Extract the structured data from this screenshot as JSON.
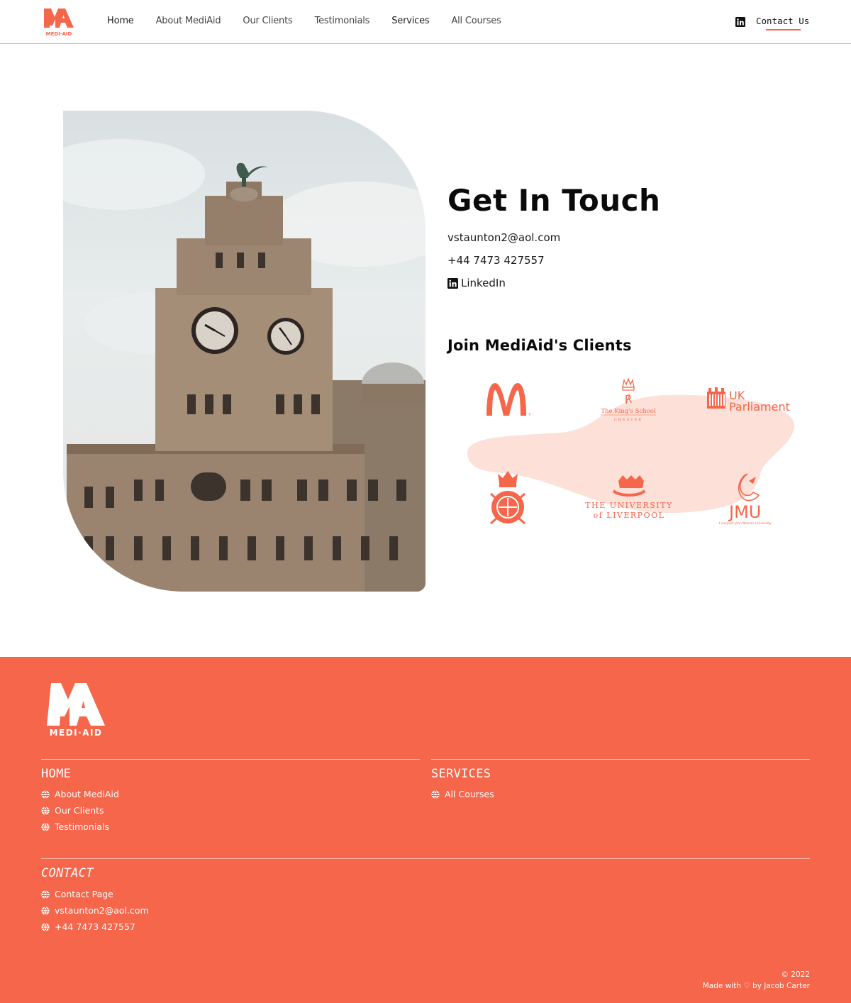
{
  "brand": {
    "logo_letters": "MA",
    "logo_wordmark": "MEDI·AID",
    "accent": "#f5664a",
    "blob": "#fde0d8"
  },
  "nav": {
    "links": [
      "Home",
      "About MediAid",
      "Our Clients",
      "Testimonials",
      "Services",
      "All Courses"
    ],
    "contact_label": "Contact Us",
    "linkedin_icon": "linkedin-icon"
  },
  "contact": {
    "title": "Get In Touch",
    "email": "vstaunton2@aol.com",
    "phone": "+44 7473 427557",
    "linkedin_label": "LinkedIn"
  },
  "clients": {
    "title": "Join MediAid's Clients",
    "logos": [
      {
        "name": "McDonald's",
        "icon": "mcdonalds-logo"
      },
      {
        "name": "The King's School",
        "sub": "CHESTER",
        "icon": "kings-school-logo"
      },
      {
        "name": "UK Parliament",
        "line1": "UK",
        "line2": "Parliament",
        "icon": "uk-parliament-logo"
      },
      {
        "name": "Royal crest",
        "icon": "crest-logo"
      },
      {
        "name": "The University of Liverpool",
        "line1": "THE UNIVERSITY",
        "line2": "of LIVERPOOL",
        "icon": "university-of-liverpool-logo"
      },
      {
        "name": "JMU",
        "line1": "JMU",
        "line2": "Liverpool John Moores University",
        "icon": "ljmu-logo"
      }
    ]
  },
  "footer": {
    "home_heading": "HOME",
    "home_items": [
      "About MediAid",
      "Our Clients",
      "Testimonials"
    ],
    "services_heading": "SERVICES",
    "services_items": [
      "All Courses"
    ],
    "contact_heading": "CONTACT",
    "contact_items": [
      "Contact Page",
      "vstaunton2@aol.com",
      "+44 7473 427557"
    ],
    "copyright": "© 2022",
    "credit": "Made with ♡ by Jacob Carter"
  }
}
